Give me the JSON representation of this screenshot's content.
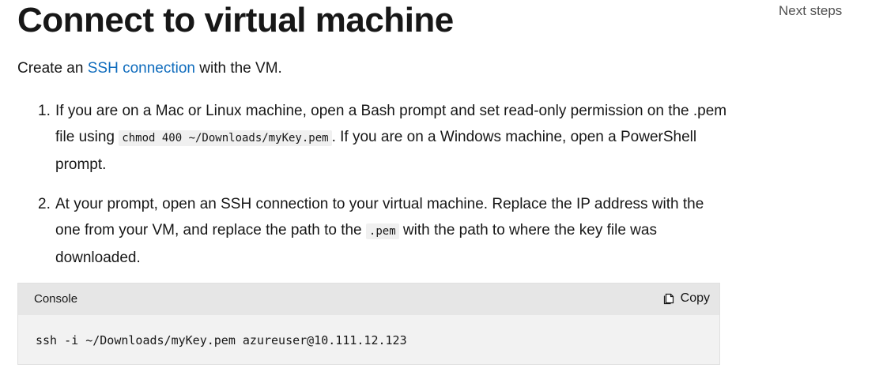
{
  "article": {
    "title": "Connect to virtual machine",
    "intro": {
      "before": "Create an ",
      "link": "SSH connection",
      "after": " with the VM."
    },
    "steps": [
      {
        "number": "1.",
        "text_before": "If you are on a Mac or Linux machine, open a Bash prompt and set read-only permission on the .pem file using ",
        "code": "chmod 400 ~/Downloads/myKey.pem",
        "text_after": ". If you are on a Windows machine, open a PowerShell prompt."
      },
      {
        "number": "2.",
        "text_before": "At your prompt, open an SSH connection to your virtual machine. Replace the IP address with the one from your VM, and replace the path to the ",
        "code": ".pem",
        "text_after": " with the path to where the key file was downloaded."
      }
    ],
    "code_block": {
      "language": "Console",
      "copy_label": "Copy",
      "copy_icon": "copy-icon",
      "code": "ssh -i ~/Downloads/myKey.pem azureuser@10.111.12.123"
    }
  },
  "toc": {
    "next_steps": "Next steps"
  },
  "colors": {
    "link": "#0f6cbd",
    "text": "#171717",
    "code_header_bg": "#e6e6e6",
    "code_body_bg": "#f2f2f2"
  }
}
